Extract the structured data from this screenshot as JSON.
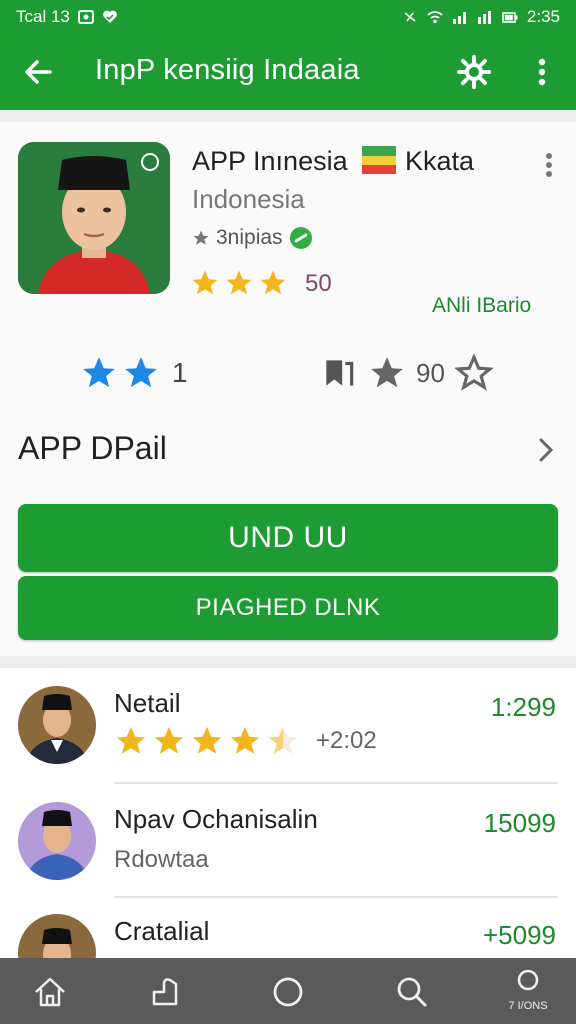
{
  "status": {
    "left_text": "Tcal 13",
    "time": "2:35"
  },
  "toolbar": {
    "title": "InpP kensiig Indaaia"
  },
  "app": {
    "name": "APP Inınesia",
    "name2": "Kkata",
    "country": "Indonesia",
    "scripts": "3nipias",
    "rating_value": "50",
    "developer_link": "ANli IBario"
  },
  "stats": {
    "left_count": "1",
    "right_count": "90"
  },
  "detail": {
    "label": "APP DPail"
  },
  "buttons": {
    "primary": "UND UU",
    "secondary": "PIAGHED DLNK"
  },
  "list": [
    {
      "name": "Netail",
      "extra": "+2:02",
      "price": "1:299",
      "stars": 4.5
    },
    {
      "name": "Npav Ochanisalin",
      "sub": "Rdowtaa",
      "price": "15099"
    },
    {
      "name": "Cratalial",
      "price": "+5099"
    }
  ],
  "navbar": {
    "last_label": "7 I/ONS"
  },
  "colors": {
    "brand": "#1e9c34",
    "star": "#f2b51b",
    "blue_star": "#1e88e5",
    "link": "#1b8a2f"
  }
}
